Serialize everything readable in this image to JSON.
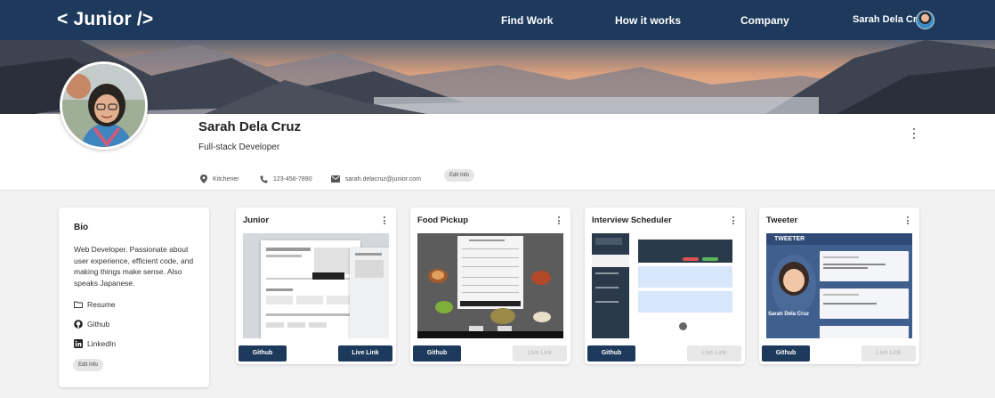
{
  "nav": {
    "logo": "< Junior />",
    "links": [
      "Find Work",
      "How it works",
      "Company"
    ],
    "user_name": "Sarah Dela Cruz"
  },
  "profile": {
    "name": "Sarah Dela Cruz",
    "role": "Full-stack Developer",
    "location": "Kitchener",
    "phone": "123-456-7890",
    "email": "sarah.delacruz@junior.com",
    "edit_label": "Edit Info"
  },
  "bio": {
    "title": "Bio",
    "text": "Web Developer. Passionate about user experience, efficient code, and making things make sense. Also speaks Japanese.",
    "links": [
      "Resume",
      "Github",
      "LinkedIn"
    ],
    "edit_label": "Edit Info"
  },
  "projects": [
    {
      "title": "Junior",
      "github_label": "Github",
      "live_label": "Live Link",
      "live_enabled": true
    },
    {
      "title": "Food Pickup",
      "github_label": "Github",
      "live_label": "Live Link",
      "live_enabled": false
    },
    {
      "title": "Interview Scheduler",
      "github_label": "Github",
      "live_label": "Live Link",
      "live_enabled": false
    },
    {
      "title": "Tweeter",
      "github_label": "Github",
      "live_label": "Live Link",
      "live_enabled": false
    }
  ],
  "screenshots": {
    "tweeter": {
      "header": "TWEETER",
      "user": "Sarah Dela Cruz"
    }
  },
  "colors": {
    "nav": "#1d3a5c",
    "button": "#1d3a5c",
    "background": "#f2f2f2"
  },
  "icons": [
    "map-pin-icon",
    "phone-icon",
    "mail-icon",
    "folder-icon",
    "github-icon",
    "linkedin-icon",
    "kebab-menu-icon"
  ]
}
